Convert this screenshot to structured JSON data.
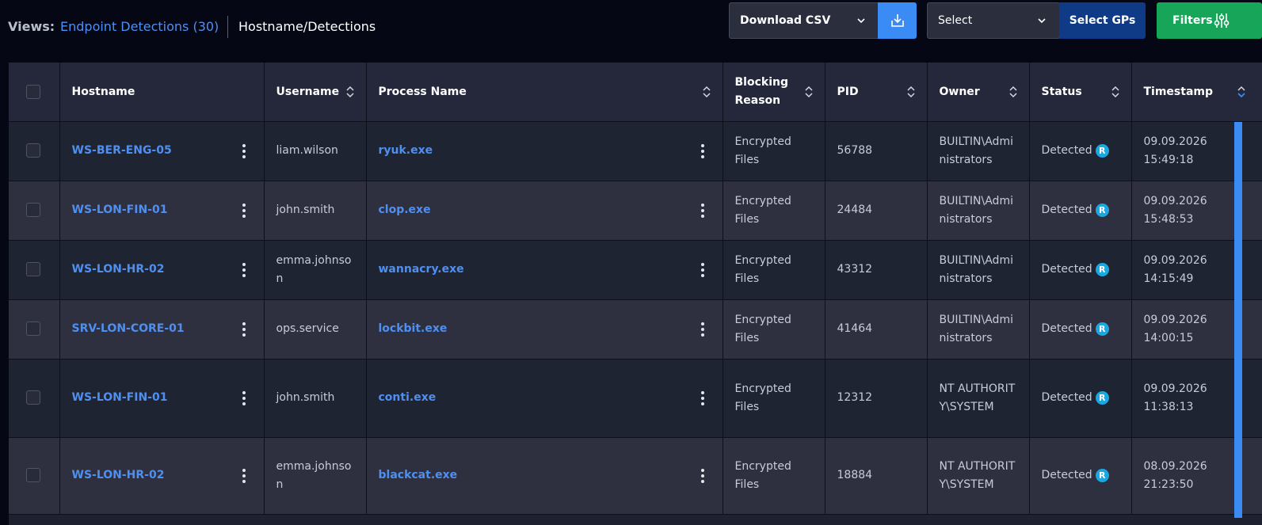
{
  "views": {
    "label": "Views:",
    "link": "Endpoint Detections (30)",
    "current": "Hostname/Detections"
  },
  "toolbar": {
    "download_label": "Download CSV",
    "select_label": "Select",
    "gps_label": "Select GPs",
    "filters_label": "Filters"
  },
  "colors": {
    "accent": "#3b8bf5",
    "filters": "#17a55a",
    "gps": "#0f3b86",
    "badge": "#1ba7e0"
  },
  "columns": {
    "hostname": "Hostname",
    "username": "Username",
    "process": "Process Name",
    "blocking_1": "Blocking",
    "blocking_2": "Reason",
    "pid": "PID",
    "owner": "Owner",
    "status": "Status",
    "timestamp": "Timestamp"
  },
  "rows": [
    {
      "hostname": "WS-BER-ENG-05",
      "username": "liam.wilson",
      "process": "ryuk.exe",
      "reason": "Encrypted Files",
      "pid": "56788",
      "owner": "BUILTIN\\Administrators",
      "status": "Detected",
      "badge": "R",
      "date": "09.09.2026",
      "time": "15:49:18"
    },
    {
      "hostname": "WS-LON-FIN-01",
      "username": "john.smith",
      "process": "clop.exe",
      "reason": "Encrypted Files",
      "pid": "24484",
      "owner": "BUILTIN\\Administrators",
      "status": "Detected",
      "badge": "R",
      "date": "09.09.2026",
      "time": "15:48:53"
    },
    {
      "hostname": "WS-LON-HR-02",
      "username": "emma.johnson",
      "process": "wannacry.exe",
      "reason": "Encrypted Files",
      "pid": "43312",
      "owner": "BUILTIN\\Administrators",
      "status": "Detected",
      "badge": "R",
      "date": "09.09.2026",
      "time": "14:15:49"
    },
    {
      "hostname": "SRV-LON-CORE-01",
      "username": "ops.service",
      "process": "lockbit.exe",
      "reason": "Encrypted Files",
      "pid": "41464",
      "owner": "BUILTIN\\Administrators",
      "status": "Detected",
      "badge": "R",
      "date": "09.09.2026",
      "time": "14:00:15"
    },
    {
      "hostname": "WS-LON-FIN-01",
      "username": "john.smith",
      "process": "conti.exe",
      "reason": "Encrypted Files",
      "pid": "12312",
      "owner": "NT AUTHORITY\\SYSTEM",
      "status": "Detected",
      "badge": "R",
      "date": "09.09.2026",
      "time": "11:38:13"
    },
    {
      "hostname": "WS-LON-HR-02",
      "username": "emma.johnson",
      "process": "blackcat.exe",
      "reason": "Encrypted Files",
      "pid": "18884",
      "owner": "NT AUTHORITY\\SYSTEM",
      "status": "Detected",
      "badge": "R",
      "date": "08.09.2026",
      "time": "21:23:50"
    }
  ]
}
